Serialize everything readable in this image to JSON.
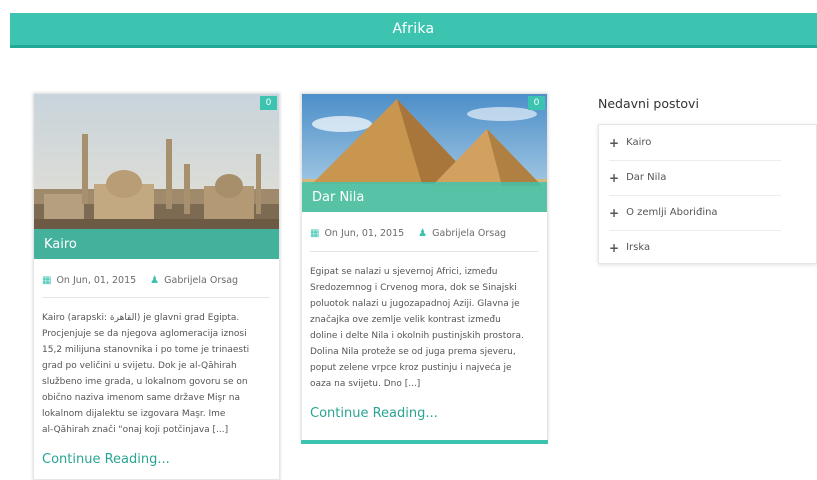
{
  "header": {
    "title": "Afrika"
  },
  "posts": [
    {
      "title": "Kairo",
      "badge": "0",
      "date": "On Jun, 01, 2015",
      "author": "Gabrijela Orsag",
      "excerpt": [
        "Kairo (arapski: القاهرة) je glavni grad Egipta.",
        "Procjenjuje se da njegova aglomeracija iznosi",
        "15,2 milijuna stanovnika i po tome je trinaesti",
        "grad po veličini u svijetu. Dok je al-Qāhirah",
        "službeno ime grada, u lokalnom govoru se on",
        "obično naziva imenom same države Mişr na",
        "lokalnom dijalektu se izgovara Maşr. Ime",
        "al-Qāhirah znači \"onaj koji potčinjava [...]"
      ],
      "continue": "Continue Reading..."
    },
    {
      "title": "Dar Nila",
      "badge": "0",
      "date": "On Jun, 01, 2015",
      "author": "Gabrijela Orsag",
      "excerpt": [
        "Egipat se nalazi u sjevernoj Africi, između",
        "Sredozemnog i Crvenog mora, dok se Sinajski",
        "poluotok nalazi u jugozapadnoj Aziji. Glavna je",
        "značajka ove zemlje velik kontrast između",
        "doline i delte Nila i okolnih pustinjskih prostora.",
        "Dolina Nila proteže se od juga prema sjeveru,",
        "poput zelene vrpce kroz pustinju i najveća je",
        "oaza na svijetu. Dno [...]"
      ],
      "continue": "Continue Reading..."
    }
  ],
  "sidebar": {
    "title": "Nedavni postovi",
    "items": [
      "Kairo",
      "Dar Nila",
      "O zemlji Aboriđina",
      "Irska"
    ]
  },
  "colors": {
    "accent": "#3cc4b0",
    "accent_dark": "#22a896",
    "link": "#2aa493"
  },
  "icons": {
    "date": "calendar-icon",
    "author": "user-icon",
    "list": "plus-icon"
  }
}
